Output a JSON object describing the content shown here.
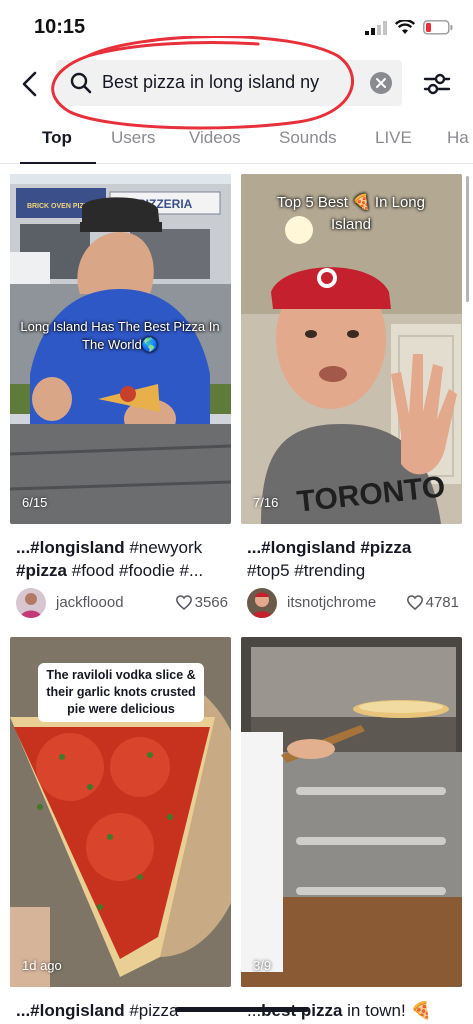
{
  "status_bar": {
    "time": "10:15"
  },
  "search": {
    "query": "Best pizza in long island ny"
  },
  "tabs": [
    {
      "label": "Top"
    },
    {
      "label": "Users"
    },
    {
      "label": "Videos"
    },
    {
      "label": "Sounds"
    },
    {
      "label": "LIVE"
    },
    {
      "label": "Ha"
    }
  ],
  "videos": [
    {
      "overlay": "Long Island Has The Best Pizza In The World🌎",
      "date": "6/15",
      "caption_line1_bold": "...#longisland",
      "caption_line1_rest": " #newyork",
      "caption_line2_bold": "#pizza",
      "caption_line2_rest": " #food #foodie #...",
      "username": "jackfloood",
      "likes": "3566",
      "store_sign": "PIZZERIA",
      "store_banner": "BRICK OVEN PIZZA"
    },
    {
      "overlay": "Top 5 Best 🍕 In Long Island",
      "date": "7/16",
      "caption_line1_bold": "...#longisland #pizza",
      "caption_line1_rest": "",
      "caption_line2_bold": "",
      "caption_line2_rest": "#top5 #trending",
      "username": "itsnotjchrome",
      "likes": "4781",
      "shirt_text": "TORONTO"
    },
    {
      "overlay": "The raviloli vodka slice & their garlic knots crusted pie were delicious",
      "date": "1d ago",
      "caption_bold": "...#longisland",
      "caption_rest": " #pizza"
    },
    {
      "overlay": "",
      "date": "3/9",
      "caption_pre": "...",
      "caption_bold": "best pizza",
      "caption_rest": " in town! 🍕"
    }
  ]
}
